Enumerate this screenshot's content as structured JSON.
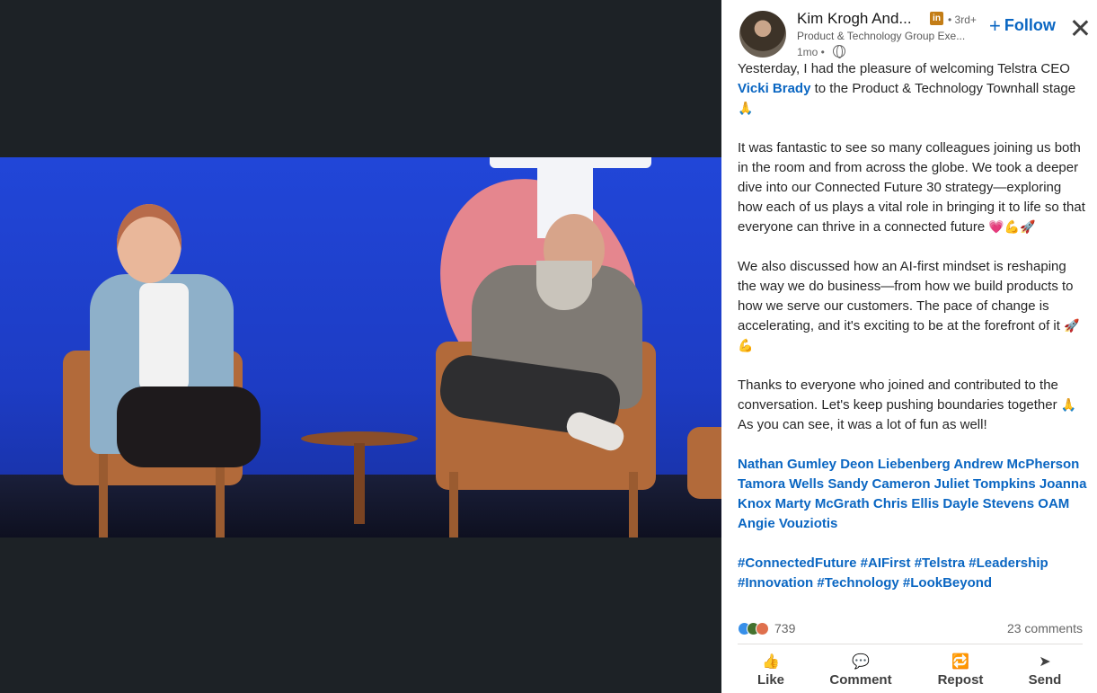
{
  "author": {
    "name": "Kim Krogh And...",
    "badge": "in",
    "degree": "• 3rd+",
    "headline": "Product & Technology Group Exe...",
    "time": "1mo •"
  },
  "follow_label": "Follow",
  "post": {
    "p1_a": "Yesterday, I had the pleasure of welcoming Telstra CEO ",
    "p1_mention": "Vicki Brady",
    "p1_b": " to the Product & Technology Townhall stage ",
    "p1_emoji": "🙏",
    "p2": "It was fantastic to see so many colleagues joining us both in the room and from across the globe. We took a deeper dive into our Connected Future 30 strategy—exploring how each of us plays a vital role in bringing it to life so that everyone can thrive in a connected future ",
    "p2_emoji": "💗💪🚀",
    "p3": "We also discussed how an AI-first mindset is reshaping the way we do business—from how we build products to how we serve our customers. The pace of change is accelerating, and it's exciting to be at the forefront of it ",
    "p3_emoji": "🚀💪",
    "p4_a": "Thanks to everyone who joined and contributed to the conversation. Let's keep pushing boundaries together ",
    "p4_emoji": "🙏",
    "p4_b": " As you can see, it was a lot of fun as well!",
    "mentions": "Nathan Gumley Deon Liebenberg Andrew McPherson  Tamora Wells Sandy Cameron Juliet Tompkins Joanna Knox Marty McGrath Chris Ellis Dayle Stevens OAM  Angie Vouziotis",
    "hashtags": "#ConnectedFuture #AIFirst #Telstra #Leadership  #Innovation #Technology #LookBeyond"
  },
  "social": {
    "reaction_count": "739",
    "comments": "23 comments"
  },
  "actions": [
    {
      "label": "Like",
      "icon": "👍"
    },
    {
      "label": "Comment",
      "icon": "💬"
    },
    {
      "label": "Repost",
      "icon": "🔁"
    },
    {
      "label": "Send",
      "icon": "➤"
    }
  ],
  "colors": {
    "accent": "#0a66c2",
    "viewer_bg": "#1d2226",
    "stage_blue": "#1d3fbf"
  }
}
